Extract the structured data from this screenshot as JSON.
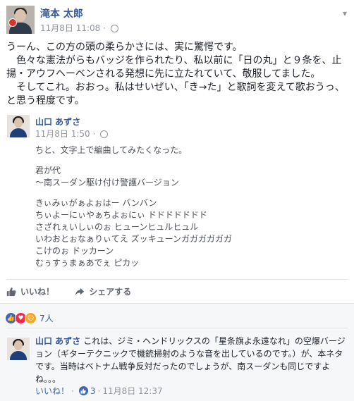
{
  "post": {
    "author": "滝本 太郎",
    "timestamp": "11月8日 11:08",
    "separator": "·",
    "menu_icon": "chevron-down-icon",
    "text_lines": [
      "うーん、この方の頭の柔らかさには、実に驚愕です。",
      "　色々な憲法がらもバッジを作られたり、私以前に「日の丸」と９条を、止揚・アウフヘーベンされる発想に先に立たれていて、敬服してました。",
      "　そしてこれ。おおっ。私はせいぜい、「き→た」と歌詞を変えて歌おうっ、と思う程度です。"
    ]
  },
  "shared_post": {
    "author": "山口 あずさ",
    "timestamp": "11月8日 1:50",
    "separator": "·",
    "intro": "ちと、文字上で編曲してみたくなった。",
    "title_lines": [
      "君が代",
      "〜南スーダン駆け付け警護バージョン"
    ],
    "lyric_lines": [
      "きぃみぃがぁよぉはー バンバン",
      "ちぃよーにぃやぁちよぉにぃ ドドドドドドド",
      "さざれぇいしぃのぉ ヒューンヒュルヒュル",
      "いわおとぉなぁりぃてえ ズッキューンガガガガガガ",
      "こけのぉ ドッカーン",
      "むぅすぅまぁあでぇ ピカッ"
    ]
  },
  "actions": {
    "like_label": "いいね！",
    "share_label": "シェアする"
  },
  "reactions": {
    "count": "7人",
    "types": [
      "like",
      "love",
      "angry"
    ],
    "colors": {
      "like": "#4267b2",
      "love": "#f0284a",
      "angry": "#f5a623"
    }
  },
  "comment": {
    "author": "山口 あずさ",
    "text": "これは、ジミ・ヘンドリックスの「星条旗よ永遠なれ」の空爆バージョン（ギターテクニックで機銃掃射のような音を出しているのです。）が、本ネタです。当時はベトナム戦争反対だったのでしょうが、南スーダンも同じですよね。。。",
    "like_label": "いいね！",
    "dot": "·",
    "like_count": "3",
    "timestamp": "11月8日 12:37"
  }
}
